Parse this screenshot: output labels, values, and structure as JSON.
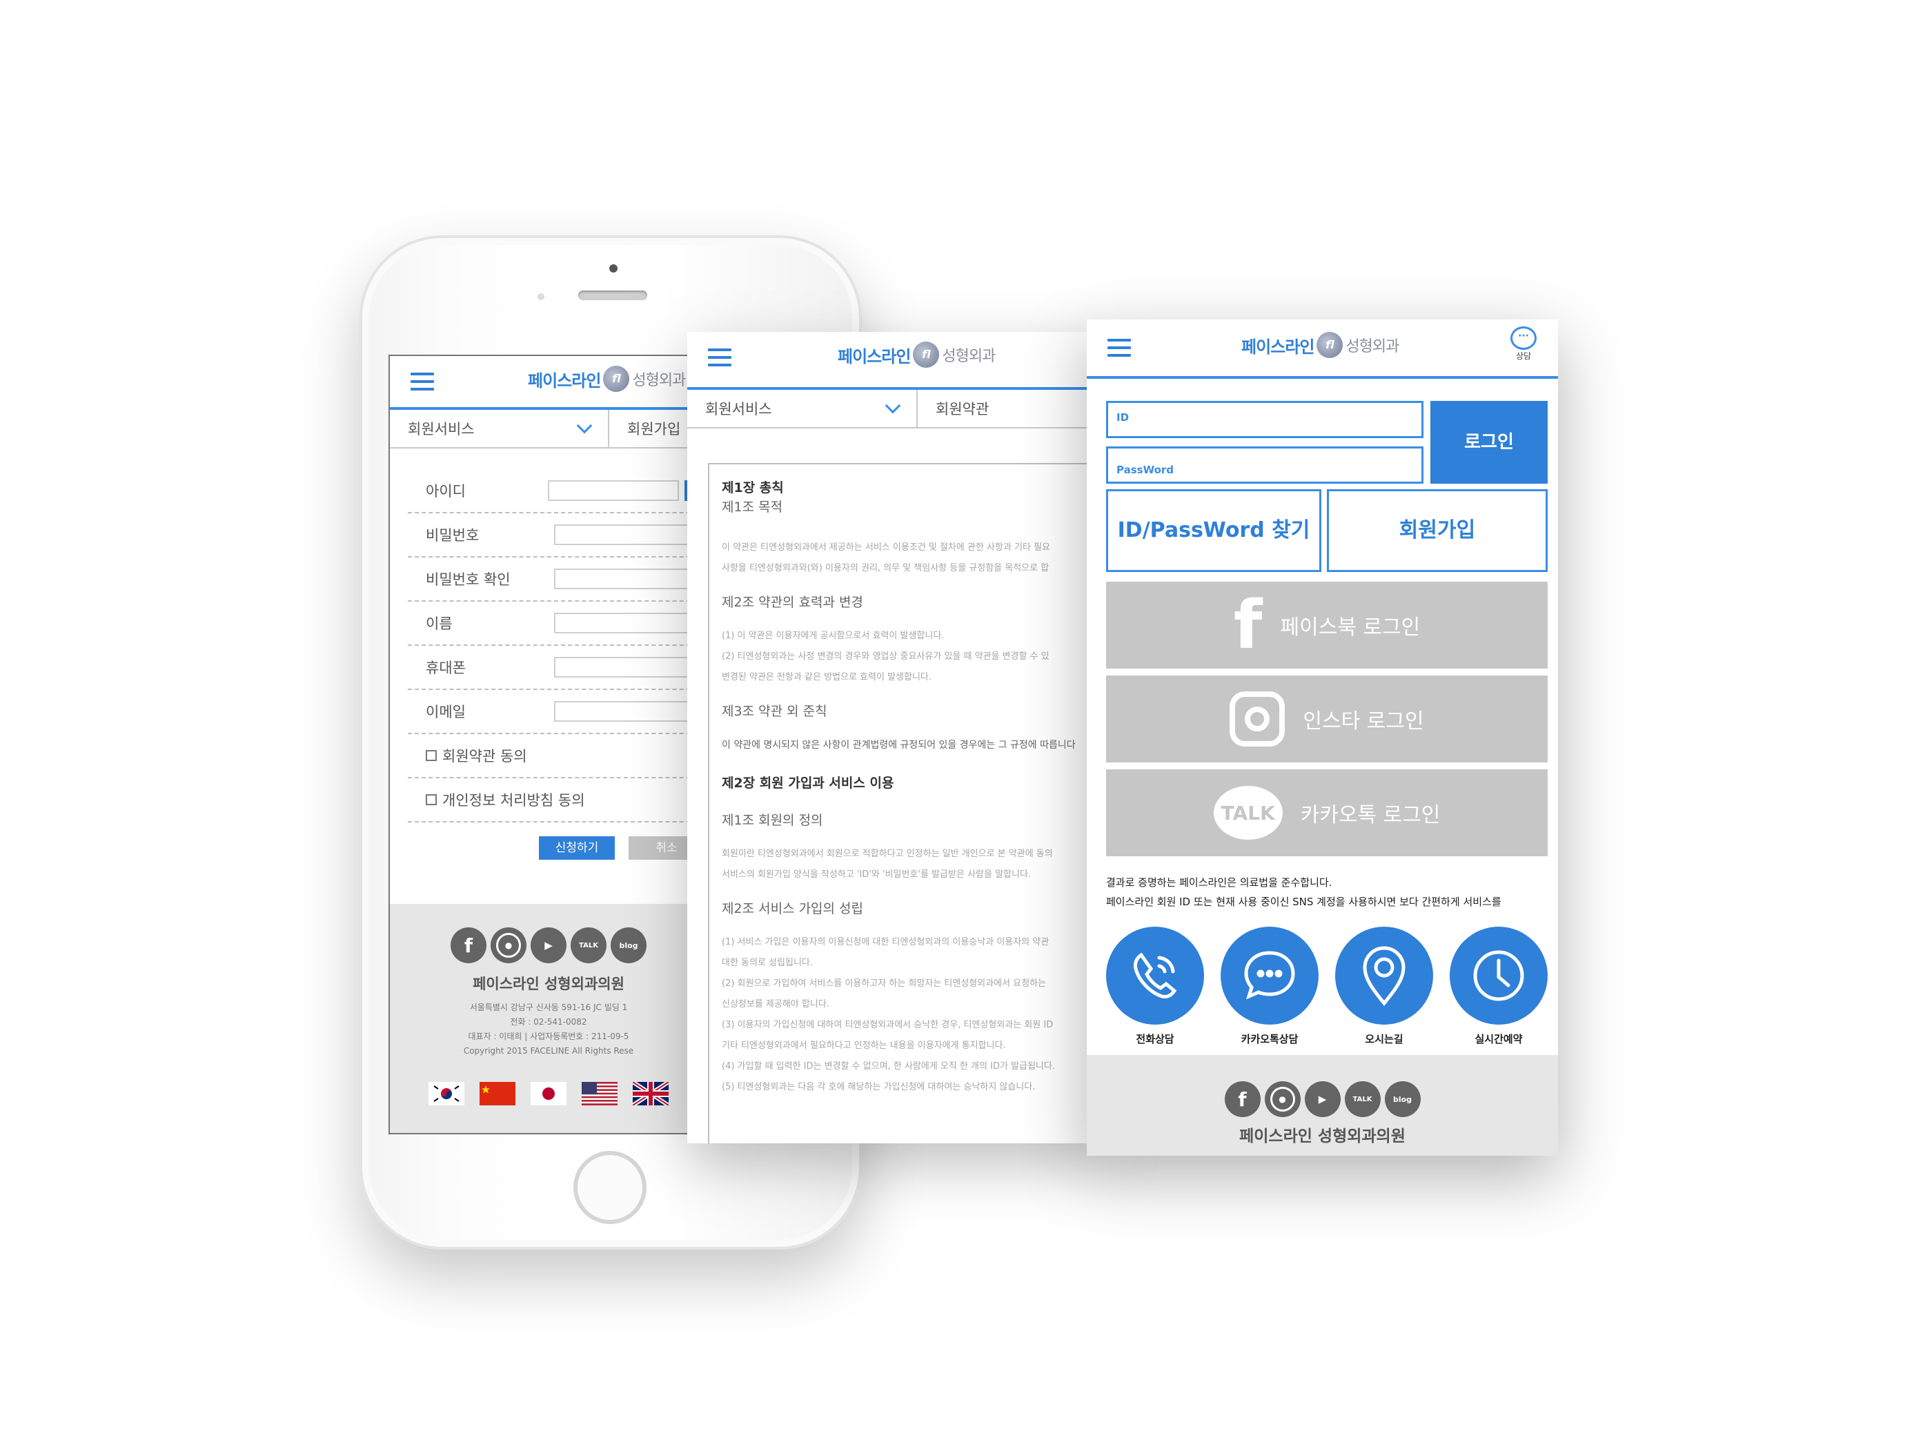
{
  "logo": {
    "main": "페이스라인",
    "emblem": "fl",
    "sub": "성형외과"
  },
  "left_screen": {
    "subnav": [
      "회원서비스",
      "회원가입"
    ],
    "form_fields": [
      {
        "label": "아이디",
        "value": ""
      },
      {
        "label": "비밀번호",
        "value": ""
      },
      {
        "label": "비밀번호 확인",
        "value": ""
      },
      {
        "label": "이름",
        "value": ""
      },
      {
        "label": "휴대폰",
        "value": ""
      },
      {
        "label": "이메일",
        "value": ""
      }
    ],
    "agreements": [
      "회원약관 동의",
      "개인정보 처리방침 동의"
    ],
    "apply_label": "신청하기",
    "cancel_label": "취소",
    "footer": {
      "social": [
        "facebook-icon",
        "instagram-icon",
        "youtube-icon",
        "kakaotalk-icon",
        "blog-icon"
      ],
      "social_talk": "TALK",
      "social_blog": "blog",
      "clinic_name": "페이스라인 성형외과의원",
      "address": "서울특별시 강남구 신사동 591-16 JC 빌딩 1",
      "phone": "전화 : 02-541-0082",
      "biz": "대표자 : 이태희 | 사업자등록번호 : 211-09-5",
      "copyright": "Copyright 2015 FACELINE All Rights Rese"
    },
    "flags": [
      "korea-flag",
      "china-flag",
      "japan-flag",
      "usa-flag",
      "uk-flag"
    ]
  },
  "mid_screen": {
    "subnav": [
      "회원서비스",
      "회원약관"
    ],
    "terms": {
      "ch1": "제1장 총칙",
      "a1": "제1조 목적",
      "a1_body": [
        "이 약관은 티엔성형외과에서 제공하는 서비스 이용조건 및 절차에 관한 사항과 기타 필요",
        "사항을 티엔성형외과와(와) 이용자의 권리, 의무 및 책임사항 등을 규정함을 목적으로 합"
      ],
      "a2": "제2조 약관의 효력과 변경",
      "a2_body": [
        "(1) 이 약관은 이용자에게 공시함으로서 효력이 발생합니다.",
        "(2) 티엔성형외과는 사정 변경의 경우와 영업상 중요사유가 있을 때 약관을 변경할 수 있",
        "변경된 약관은 전항과 같은 방법으로 효력이 발생합니다."
      ],
      "a3": "제3조 약관 외 준칙",
      "a3_body": "이 약관에 명시되지 않은 사항이 관계법령에 규정되어 있을 경우에는 그 규정에 따릅니다",
      "ch2": "제2장 회원 가입과 서비스 이용",
      "b1": "제1조 회원의 정의",
      "b1_body": [
        "회원이란 티엔성형외과에서 회원으로 적합하다고 인정하는 일반 개인으로 본 약관에 동의",
        "서비스의 회원가입 양식을 작성하고 'ID'와 '비밀번호'를 발급받은 사람을 말합니다."
      ],
      "b2": "제2조 서비스 가입의 성립",
      "b2_body": [
        "(1) 서비스 가입은 이용자의 이용신청에 대한 티엔성형외과의 이용승낙과 이용자의 약관",
        "대한 동의로 성립됩니다.",
        "(2) 회원으로 가입하여 서비스를 이용하고자 하는 희망자는 티엔성형외과에서 요청하는",
        "신상정보를 제공해야 합니다.",
        "(3) 이용자의 가입신청에 대하여 티엔성형외과에서 승낙한 경우, 티엔성형외과는 회원 ID",
        "기타 티엔성형외과에서 필요하다고 인정하는 내용을 이용자에게 통지합니다.",
        "(4) 가입할 때 입력한 ID는 변경할 수 없으며, 한 사람에게 오직 한 개의 ID가 발급됩니다.",
        "(5) 티엔성형외과는 다음 각 호에 해당하는 가입신청에 대하여는 승낙하지 않습니다."
      ]
    }
  },
  "right_screen": {
    "consult_label": "상담",
    "id_placeholder": "ID",
    "pw_placeholder": "PassWord",
    "login_label": "로그인",
    "find_label": "ID/PassWord 찾기",
    "join_label": "회원가입",
    "sns": [
      {
        "icon": "facebook-icon",
        "glyph": "f",
        "label": "페이스북 로그인"
      },
      {
        "icon": "instagram-icon",
        "glyph": "",
        "label": "인스타 로그인"
      },
      {
        "icon": "kakaotalk-icon",
        "glyph": "TALK",
        "label": "카카오톡 로그인"
      }
    ],
    "notice": [
      "결과로 증명하는 페이스라인은 의료법을 준수합니다.",
      "페이스라인 회원 ID 또는 현재 사용 중이신 SNS 계정을 사용하시면 보다 간편하게 서비스를"
    ],
    "quick": [
      {
        "icon": "phone-icon",
        "label": "전화상담"
      },
      {
        "icon": "chat-icon",
        "label": "카카오톡상담"
      },
      {
        "icon": "location-icon",
        "label": "오시는길"
      },
      {
        "icon": "clock-icon",
        "label": "실시간예약"
      }
    ],
    "clinic_name": "페이스라인 성형외과의원"
  },
  "colors": {
    "accent": "#2f80d8",
    "sns_gray": "#c6c6c6",
    "footer_gray": "#e6e6e6"
  }
}
